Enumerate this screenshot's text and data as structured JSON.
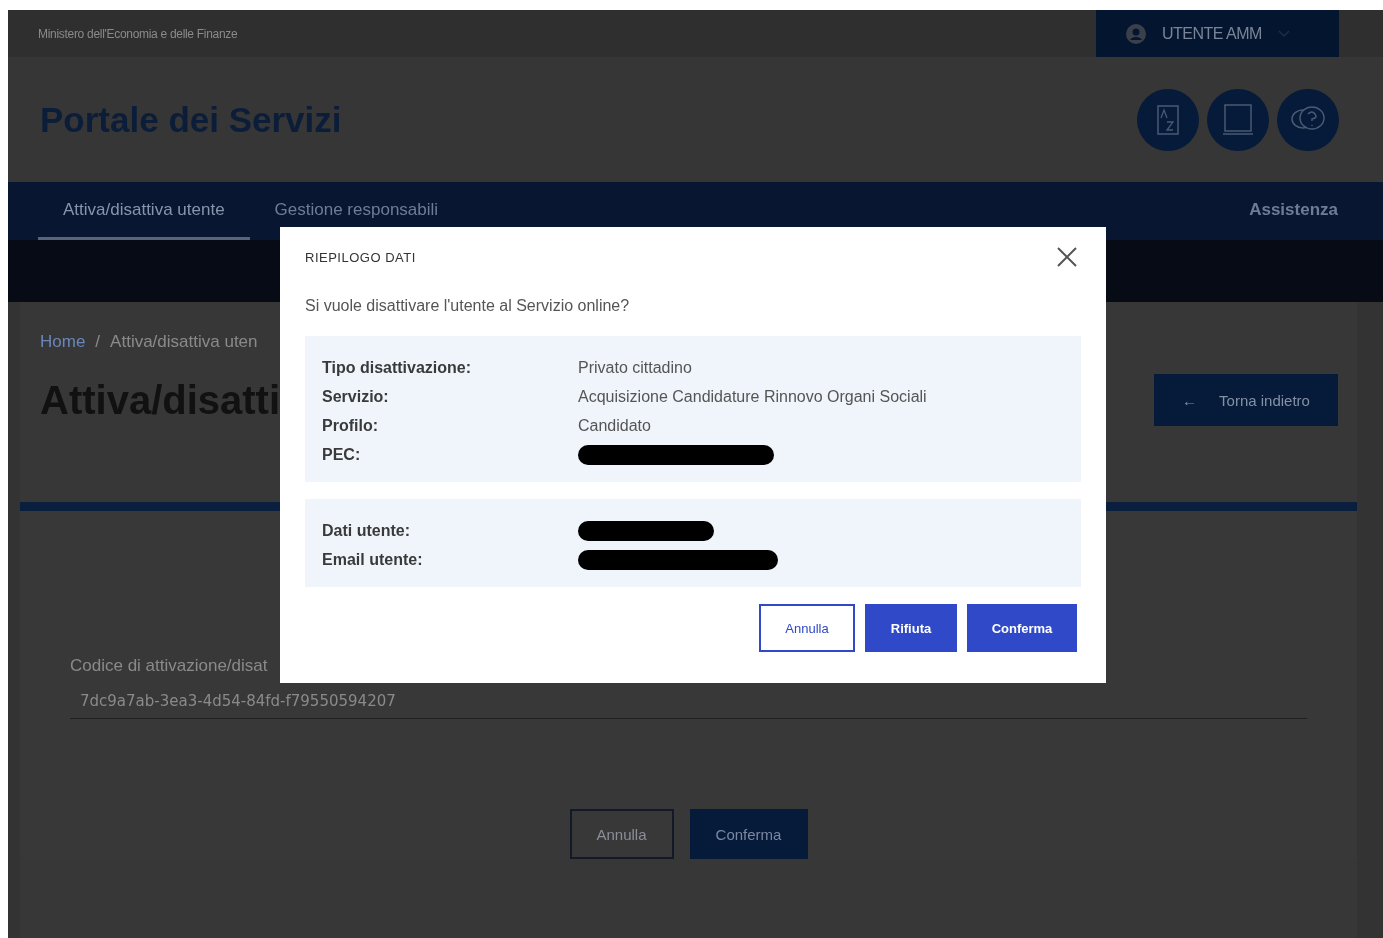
{
  "top_bar": {
    "ministry": "Ministero dell'Economia e delle Finanze",
    "user_menu": "UTENTE AMM"
  },
  "header": {
    "title": "Portale dei Servizi"
  },
  "nav": {
    "items": [
      {
        "label": "Attiva/disattiva utente",
        "selected": true
      },
      {
        "label": "Gestione responsabili",
        "selected": false
      }
    ],
    "right_item": "Assistenza"
  },
  "page": {
    "breadcrumb": [
      "Home",
      "Attiva/disattiva uten"
    ],
    "breadcrumb_separator": "/",
    "title": "Attiva/disatti",
    "back_button": {
      "icon": "←",
      "label": "Torna indietro"
    },
    "field": {
      "label": "Codice di attivazione/disat",
      "value": "7dc9a7ab-3ea3-4d54-84fd-f79550594207"
    },
    "buttons": [
      {
        "label": "Annulla",
        "kind": "outline"
      },
      {
        "label": "Conferma",
        "kind": "primary"
      }
    ]
  },
  "dialog": {
    "title": "RIEPILOGO DATI",
    "question": "Si vuole disattivare l'utente al Servizio online?",
    "groups": [
      [
        {
          "label": "Tipo disattivazione:",
          "value": "Privato cittadino",
          "redacted": false
        },
        {
          "label": "Servizio:",
          "value": "Acquisizione Candidature Rinnovo Organi Sociali",
          "redacted": false
        },
        {
          "label": "Profilo:",
          "value": "Candidato",
          "redacted": false
        },
        {
          "label": "PEC:",
          "redacted": true
        }
      ],
      [
        {
          "label": "Dati utente:",
          "redacted": true
        },
        {
          "label": "Email utente:",
          "redacted": true
        }
      ]
    ],
    "buttons": [
      {
        "label": "Annulla",
        "kind": "outline"
      },
      {
        "label": "Rifiuta",
        "kind": "primary"
      },
      {
        "label": "Conferma",
        "kind": "primary"
      }
    ]
  }
}
